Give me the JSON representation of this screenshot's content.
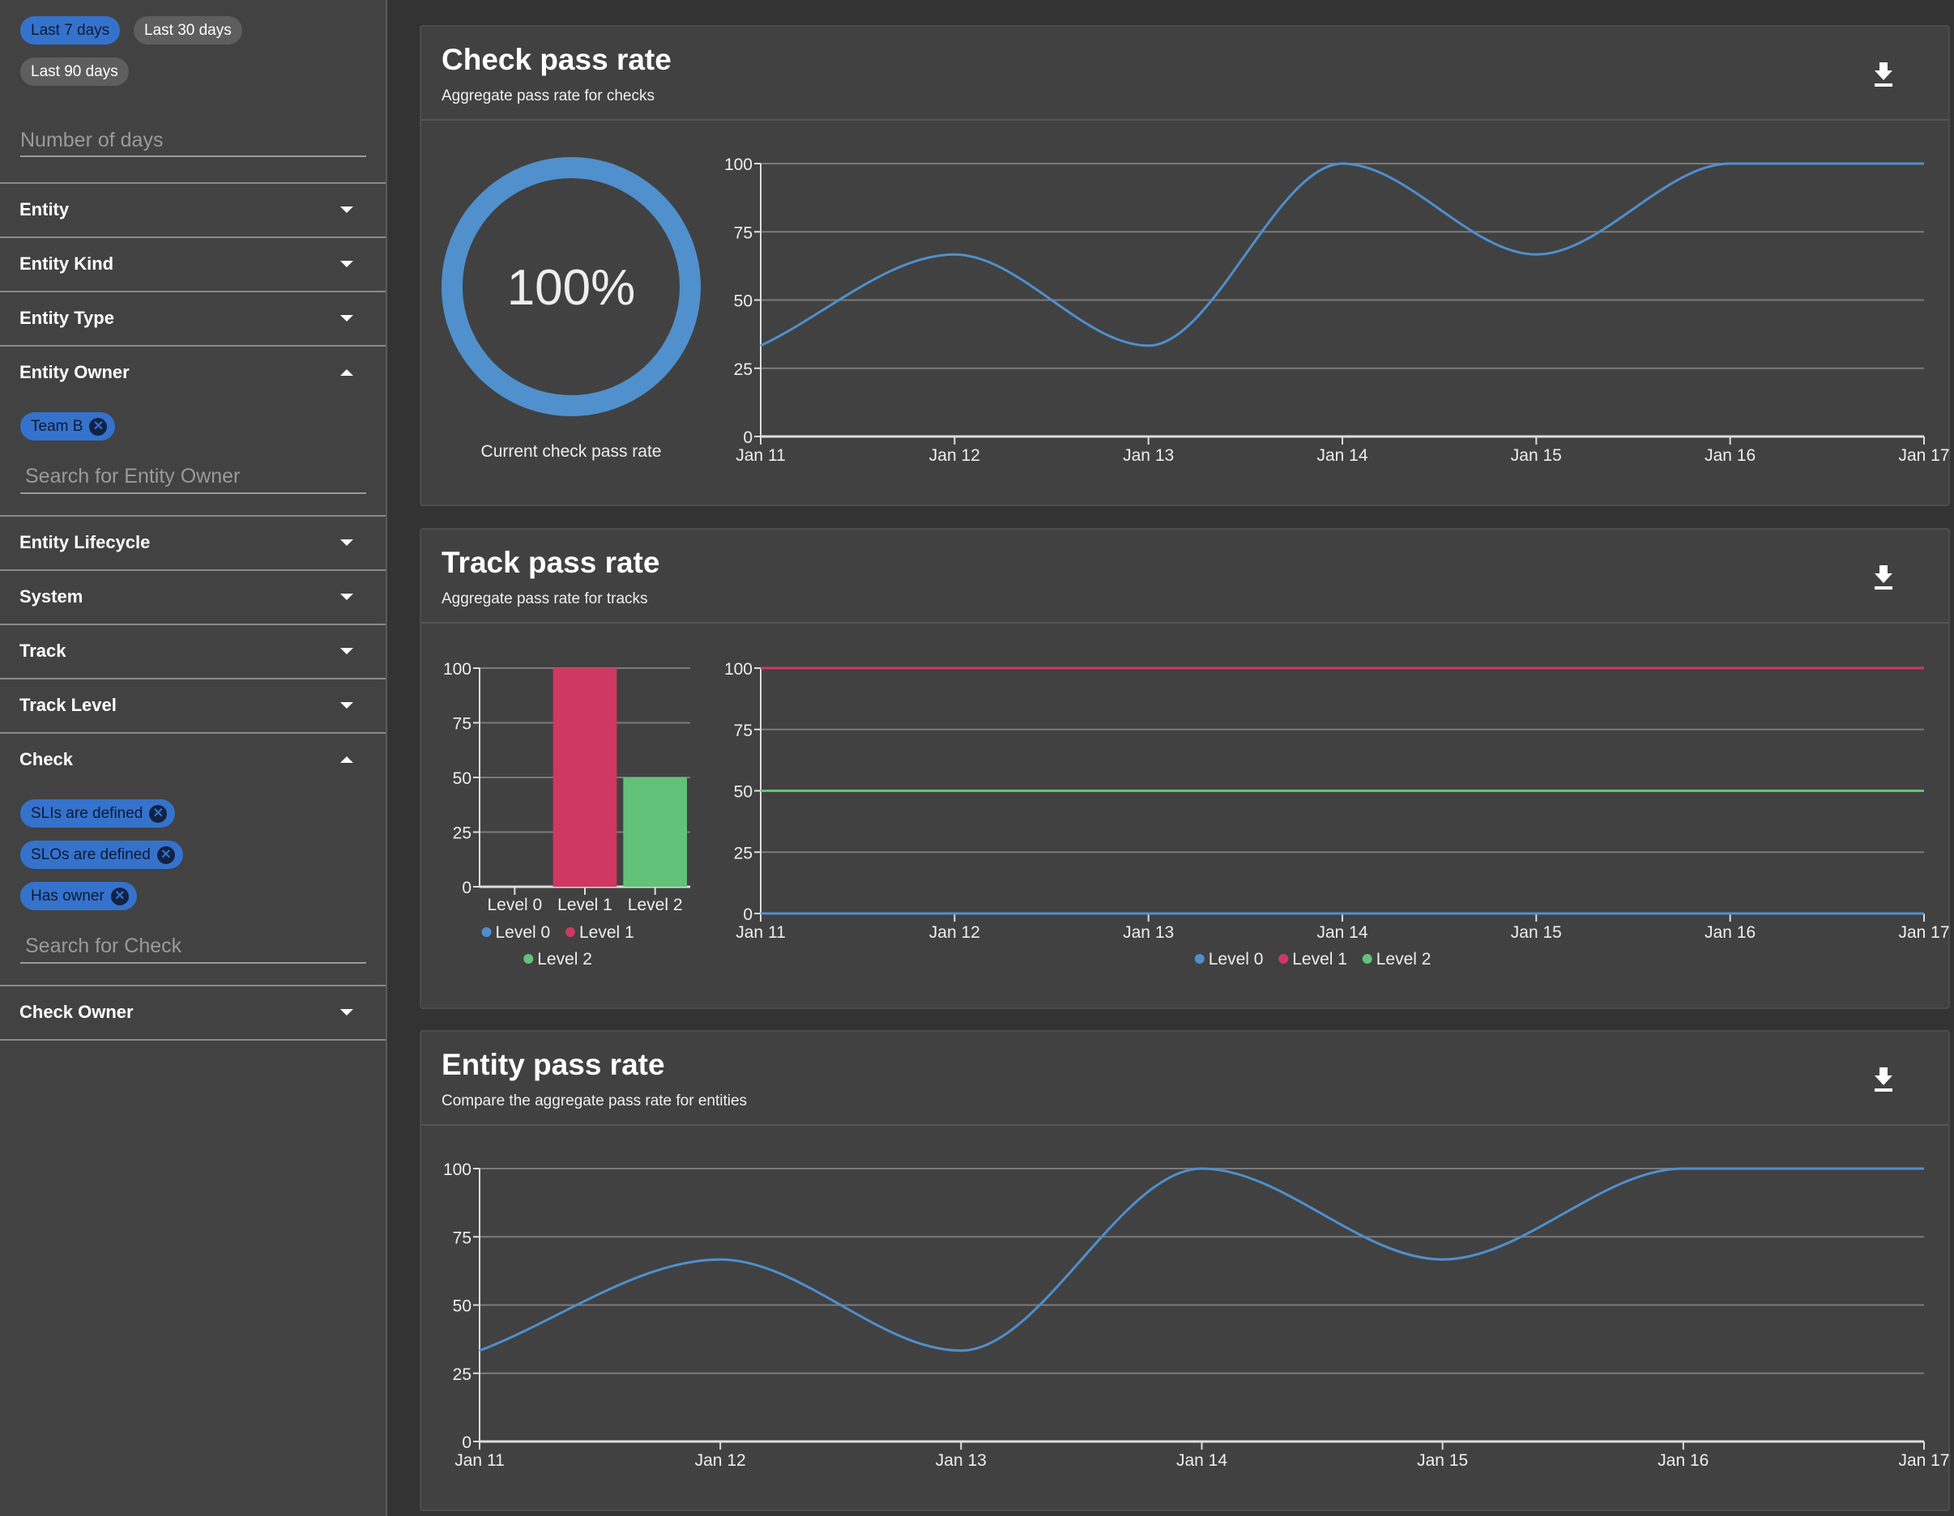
{
  "sidebar": {
    "range_chips": [
      {
        "label": "Last 7 days",
        "selected": true
      },
      {
        "label": "Last 30 days",
        "selected": false
      },
      {
        "label": "Last 90 days",
        "selected": false
      }
    ],
    "days_placeholder": "Number of days",
    "filters": [
      {
        "label": "Entity",
        "expanded": false
      },
      {
        "label": "Entity Kind",
        "expanded": false
      },
      {
        "label": "Entity Type",
        "expanded": false
      },
      {
        "label": "Entity Owner",
        "expanded": true,
        "chips": [
          "Team B"
        ],
        "search_placeholder": "Search for Entity Owner"
      },
      {
        "label": "Entity Lifecycle",
        "expanded": false
      },
      {
        "label": "System",
        "expanded": false
      },
      {
        "label": "Track",
        "expanded": false
      },
      {
        "label": "Track Level",
        "expanded": false
      },
      {
        "label": "Check",
        "expanded": true,
        "chips": [
          "SLIs are defined",
          "SLOs are defined",
          "Has owner"
        ],
        "search_placeholder": "Search for Check"
      },
      {
        "label": "Check Owner",
        "expanded": false
      }
    ]
  },
  "panels": [
    {
      "title": "Check pass rate",
      "subtitle": "Aggregate pass rate for checks",
      "download_icon": "download-icon"
    },
    {
      "title": "Track pass rate",
      "subtitle": "Aggregate pass rate for tracks",
      "download_icon": "download-icon"
    },
    {
      "title": "Entity pass rate",
      "subtitle": "Compare the aggregate pass rate for entities",
      "download_icon": "download-icon"
    }
  ],
  "gauge": {
    "value": 100,
    "display": "100%",
    "label": "Current check pass rate",
    "color": "#4f90cd"
  },
  "chart_data": [
    {
      "type": "line",
      "categories": [
        "Jan 11",
        "Jan 12",
        "Jan 13",
        "Jan 14",
        "Jan 15",
        "Jan 16",
        "Jan 17"
      ],
      "series": [
        {
          "values": [
            33.3,
            66.7,
            33.3,
            100,
            66.7,
            100,
            100
          ],
          "color": "#4f8fcc"
        }
      ],
      "ylim": [
        0,
        100
      ],
      "yticks": [
        0,
        25,
        50,
        75,
        100
      ],
      "grid": true
    },
    {
      "type": "bar",
      "categories": [
        "Level 0",
        "Level 1",
        "Level 2"
      ],
      "values": [
        0,
        100,
        50
      ],
      "colors": [
        "#4f8fcc",
        "#cf3861",
        "#62c27a"
      ],
      "legend": [
        "Level 0",
        "Level 1",
        "Level 2"
      ],
      "ylim": [
        0,
        100
      ],
      "yticks": [
        0,
        25,
        50,
        75,
        100
      ],
      "grid": true,
      "legend_position": "bottom"
    },
    {
      "type": "line",
      "categories": [
        "Jan 11",
        "Jan 12",
        "Jan 13",
        "Jan 14",
        "Jan 15",
        "Jan 16",
        "Jan 17"
      ],
      "series": [
        {
          "name": "Level 0",
          "values": [
            0,
            0,
            0,
            0,
            0,
            0,
            0
          ],
          "color": "#4f8fcc"
        },
        {
          "name": "Level 1",
          "values": [
            100,
            100,
            100,
            100,
            100,
            100,
            100
          ],
          "color": "#cf3861"
        },
        {
          "name": "Level 2",
          "values": [
            50,
            50,
            50,
            50,
            50,
            50,
            50
          ],
          "color": "#62c27a"
        }
      ],
      "ylim": [
        0,
        100
      ],
      "yticks": [
        0,
        25,
        50,
        75,
        100
      ],
      "grid": true,
      "legend_position": "bottom"
    },
    {
      "type": "line",
      "categories": [
        "Jan 11",
        "Jan 12",
        "Jan 13",
        "Jan 14",
        "Jan 15",
        "Jan 16",
        "Jan 17"
      ],
      "series": [
        {
          "values": [
            33.3,
            66.7,
            33.3,
            100,
            66.7,
            100,
            100
          ],
          "color": "#4f8fcc"
        }
      ],
      "ylim": [
        0,
        100
      ],
      "yticks": [
        0,
        25,
        50,
        75,
        100
      ],
      "grid": true
    }
  ]
}
